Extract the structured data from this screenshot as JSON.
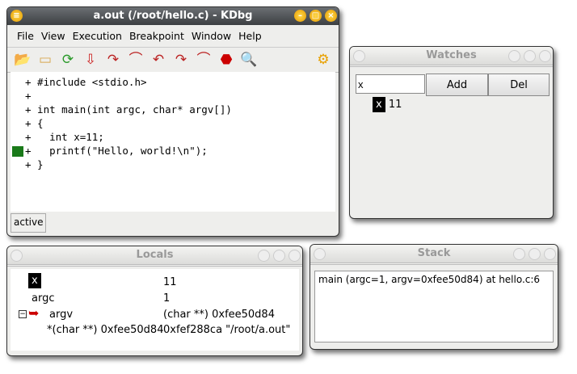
{
  "kdbg": {
    "title": "a.out (/root/hello.c) - KDbg",
    "menu": [
      "File",
      "View",
      "Execution",
      "Breakpoint",
      "Window",
      "Help"
    ],
    "toolbar_icons": [
      "open-executable-icon",
      "open-source-icon",
      "reload-icon",
      "load-core-icon",
      "step-into-icon",
      "step-over-icon",
      "step-out-icon",
      "step-into-instruction-icon",
      "step-over-instruction-icon",
      "stop-icon",
      "find-icon",
      "settings-icon"
    ],
    "code": [
      "+ #include <stdio.h>",
      "+",
      "+ int main(int argc, char* argv[])",
      "+ {",
      "+   int x=11;",
      "+   printf(\"Hello, world!\\n\");",
      "+ }"
    ],
    "status": "active"
  },
  "watches": {
    "title": "Watches",
    "input": "x",
    "add": "Add",
    "del": "Del",
    "items": [
      {
        "name": "x",
        "value": "11"
      }
    ]
  },
  "locals": {
    "title": "Locals",
    "rows": [
      {
        "name": "x",
        "value": "11"
      },
      {
        "name": "argc",
        "value": "1"
      },
      {
        "name": "argv",
        "value": "(char **) 0xfee50d84"
      },
      {
        "name": "*(char **) 0xfee50d84",
        "value": "0xfef288ca \"/root/a.out\""
      }
    ]
  },
  "stack": {
    "title": "Stack",
    "frames": [
      "main (argc=1, argv=0xfee50d84) at hello.c:6"
    ]
  }
}
